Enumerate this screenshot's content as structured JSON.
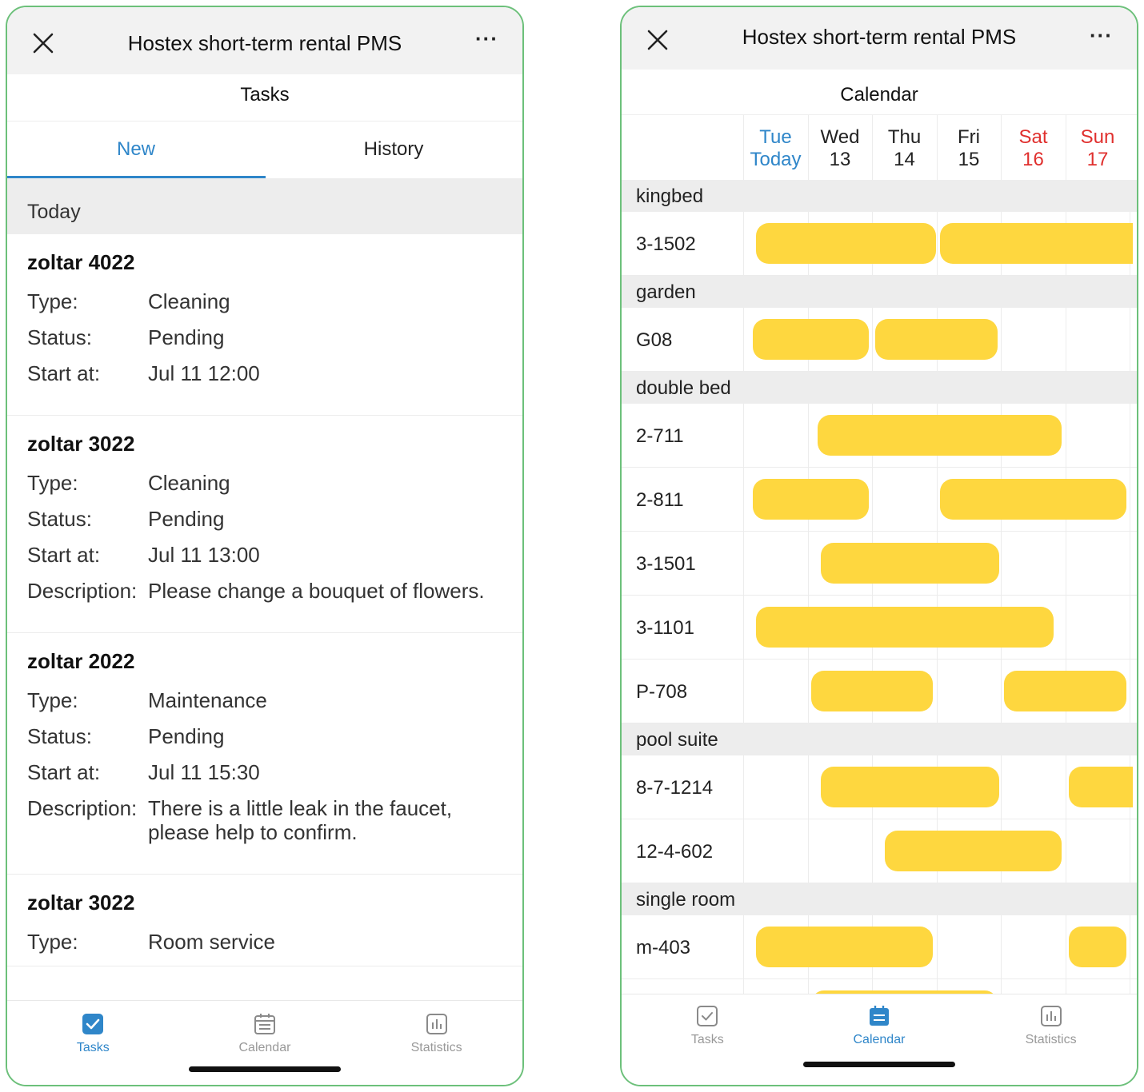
{
  "left": {
    "app_title": "Hostex short-term rental PMS",
    "page_title": "Tasks",
    "tabs": {
      "new": "New",
      "history": "History"
    },
    "section": "Today",
    "labels": {
      "type": "Type:",
      "status": "Status:",
      "start": "Start at:",
      "description": "Description:"
    },
    "tasks": [
      {
        "name": "zoltar 4022",
        "type": "Cleaning",
        "status": "Pending",
        "start": "Jul 11 12:00",
        "description": ""
      },
      {
        "name": "zoltar 3022",
        "type": "Cleaning",
        "status": "Pending",
        "start": "Jul 11 13:00",
        "description": "Please change a bouquet of flowers."
      },
      {
        "name": "zoltar 2022",
        "type": "Maintenance",
        "status": "Pending",
        "start": "Jul 11 15:30",
        "description": "There is a little leak in the faucet, please help to confirm."
      },
      {
        "name": "zoltar 3022",
        "type": "Room service",
        "status": "",
        "start": "",
        "description": ""
      }
    ],
    "tabbar": {
      "tasks": "Tasks",
      "calendar": "Calendar",
      "statistics": "Statistics",
      "active": "tasks"
    }
  },
  "right": {
    "app_title": "Hostex short-term rental PMS",
    "page_title": "Calendar",
    "days": [
      {
        "name": "Tue",
        "num": "Today",
        "kind": "today"
      },
      {
        "name": "Wed",
        "num": "13",
        "kind": "weekday"
      },
      {
        "name": "Thu",
        "num": "14",
        "kind": "weekday"
      },
      {
        "name": "Fri",
        "num": "15",
        "kind": "weekday"
      },
      {
        "name": "Sat",
        "num": "16",
        "kind": "weekend"
      },
      {
        "name": "Sun",
        "num": "17",
        "kind": "weekend"
      }
    ],
    "groups": [
      {
        "name": "kingbed",
        "rooms": [
          {
            "name": "3-1502",
            "bookings": [
              {
                "start": 0.2,
                "end": 3.0
              },
              {
                "start": 3.05,
                "end": 6.05,
                "cut": true
              }
            ]
          }
        ]
      },
      {
        "name": "garden",
        "rooms": [
          {
            "name": "G08",
            "bookings": [
              {
                "start": 0.15,
                "end": 1.95
              },
              {
                "start": 2.05,
                "end": 3.95
              }
            ]
          }
        ]
      },
      {
        "name": "double bed",
        "rooms": [
          {
            "name": "2-711",
            "bookings": [
              {
                "start": 1.15,
                "end": 4.95
              }
            ]
          },
          {
            "name": "2-811",
            "bookings": [
              {
                "start": 0.15,
                "end": 1.95
              },
              {
                "start": 3.05,
                "end": 5.95
              }
            ]
          },
          {
            "name": "3-1501",
            "bookings": [
              {
                "start": 1.2,
                "end": 3.97
              }
            ]
          },
          {
            "name": "3-1101",
            "bookings": [
              {
                "start": 0.2,
                "end": 4.82
              }
            ]
          },
          {
            "name": "P-708",
            "bookings": [
              {
                "start": 1.05,
                "end": 2.95
              },
              {
                "start": 4.05,
                "end": 5.95
              }
            ]
          }
        ]
      },
      {
        "name": "pool suite",
        "rooms": [
          {
            "name": "8-7-1214",
            "bookings": [
              {
                "start": 1.2,
                "end": 3.97
              },
              {
                "start": 5.05,
                "end": 6.05,
                "cut": true
              }
            ]
          },
          {
            "name": "12-4-602",
            "bookings": [
              {
                "start": 2.2,
                "end": 4.95
              }
            ]
          }
        ]
      },
      {
        "name": "single room",
        "rooms": [
          {
            "name": "m-403",
            "bookings": [
              {
                "start": 0.2,
                "end": 2.95
              },
              {
                "start": 5.05,
                "end": 5.95
              }
            ]
          },
          {
            "name": "",
            "bookings": [
              {
                "start": 1.05,
                "end": 3.95
              }
            ]
          }
        ]
      }
    ],
    "tabbar": {
      "tasks": "Tasks",
      "calendar": "Calendar",
      "statistics": "Statistics",
      "active": "calendar"
    }
  },
  "colors": {
    "accent": "#2f86c9",
    "weekend": "#e0302e",
    "booking": "#fed73f",
    "frame": "#6cc07a"
  },
  "icons": {
    "close": "close-icon",
    "more": "more-icon",
    "tasks": "checkbox-icon",
    "calendar": "calendar-icon",
    "statistics": "bar-chart-icon"
  }
}
